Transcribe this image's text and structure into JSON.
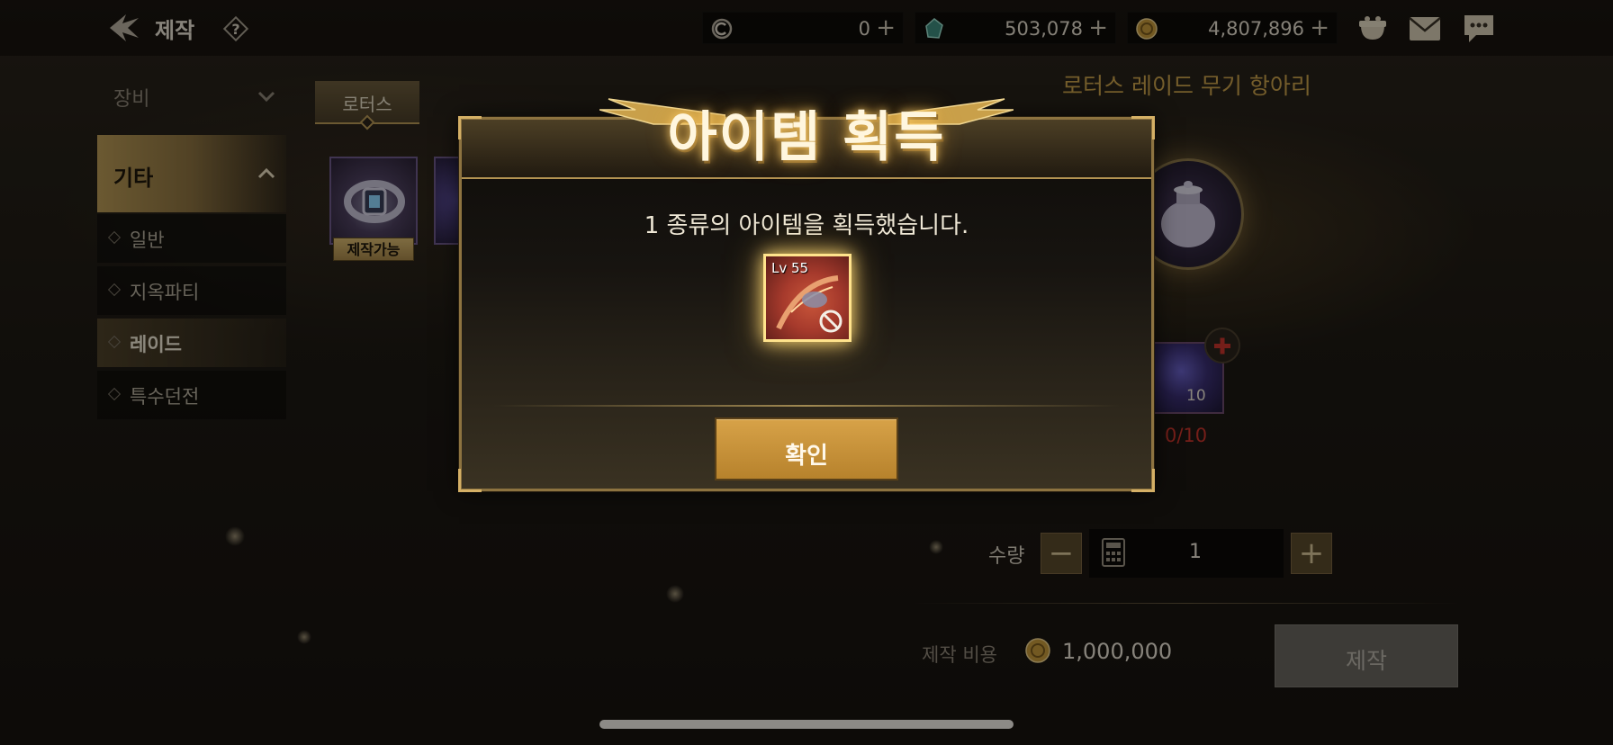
{
  "header": {
    "title": "제작",
    "currencies": [
      {
        "icon": "crystal-c-icon",
        "value": "0"
      },
      {
        "icon": "green-gem-icon",
        "value": "503,078"
      },
      {
        "icon": "gold-coin-icon",
        "value": "4,807,896"
      }
    ],
    "icons": [
      "pouch-icon",
      "mail-icon",
      "chat-icon"
    ]
  },
  "sidebar": {
    "category_equip": "장비",
    "category_other": "기타",
    "items": [
      {
        "label": "일반"
      },
      {
        "label": "지옥파티"
      },
      {
        "label": "레이드"
      },
      {
        "label": "특수던전"
      }
    ]
  },
  "tabs": {
    "lotus": "로터스"
  },
  "item_list": {
    "craftable_badge": "제작가능"
  },
  "recipe": {
    "name": "로터스 레이드 무기 항아리",
    "material_stack": "10",
    "material_owned": "0/10"
  },
  "quantity": {
    "label": "수량",
    "value": "1",
    "minus": "−",
    "plus": "+"
  },
  "cost": {
    "label": "제작 비용",
    "value": "1,000,000"
  },
  "craft_button": "제작",
  "modal": {
    "title": "아이템 획득",
    "message": "1 종류의 아이템을 획득했습니다.",
    "reward_level": "Lv 55",
    "confirm": "확인"
  },
  "colors": {
    "accent_gold": "#c9a04a",
    "confirm_button": "#c8923a",
    "warning_red": "#c8342c"
  }
}
